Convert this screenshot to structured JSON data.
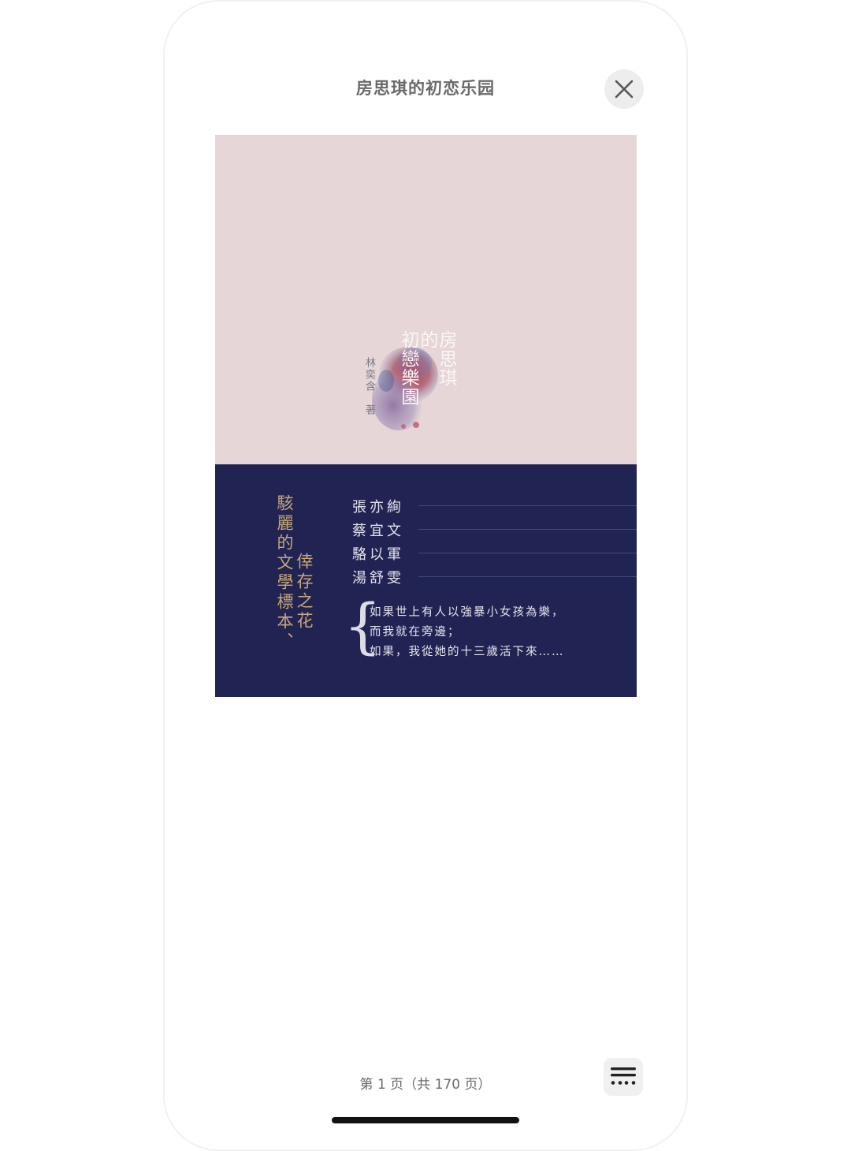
{
  "header": {
    "title": "房思琪的初恋乐园",
    "close_icon": "close-icon"
  },
  "cover": {
    "title_lines": [
      "房思琪",
      "的",
      "初戀樂園"
    ],
    "author": "林奕含　著",
    "tagline_lines": [
      "駭麗的文學標本、",
      "倖存之花"
    ],
    "recommenders": [
      "張亦絢",
      "蔡宜文",
      "駱以軍",
      "湯舒雯"
    ],
    "brace": "{",
    "quote_lines": [
      "如果世上有人以強暴小女孩為樂，",
      "而我就在旁邊；",
      "如果，我從她的十三歲活下來……"
    ],
    "colors": {
      "top_background": "#e6d6d7",
      "bottom_background": "#212353",
      "accent_gold": "#c9a876"
    }
  },
  "footer": {
    "page_indicator": "第 1 页（共 170 页）",
    "toc_icon": "menu-list-icon"
  }
}
